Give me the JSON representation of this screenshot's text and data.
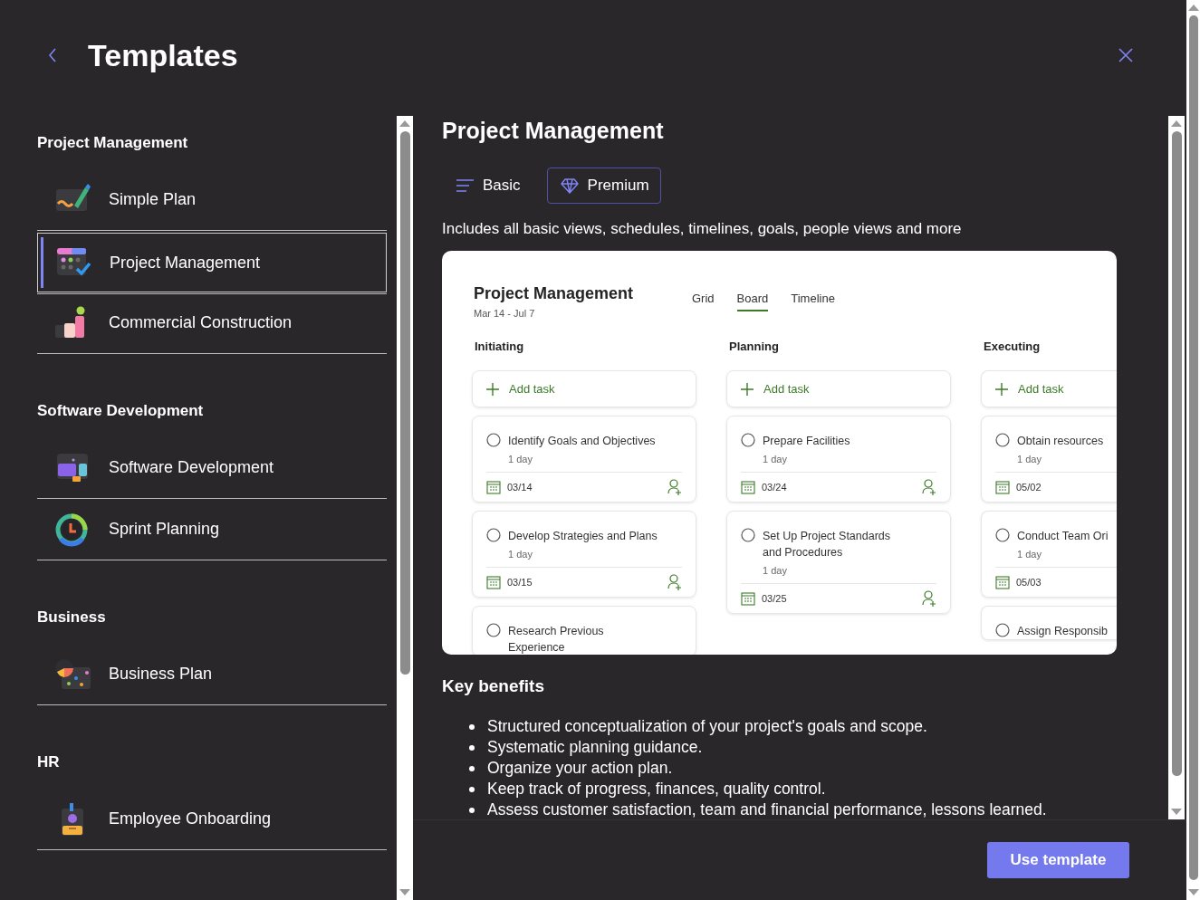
{
  "header": {
    "title": "Templates"
  },
  "sidebar": {
    "groups": [
      {
        "title": "Project Management",
        "items": [
          {
            "label": "Simple Plan",
            "selected": false
          },
          {
            "label": "Project Management",
            "selected": true
          },
          {
            "label": "Commercial Construction",
            "selected": false
          }
        ]
      },
      {
        "title": "Software Development",
        "items": [
          {
            "label": "Software Development",
            "selected": false
          },
          {
            "label": "Sprint Planning",
            "selected": false
          }
        ]
      },
      {
        "title": "Business",
        "items": [
          {
            "label": "Business Plan",
            "selected": false
          }
        ]
      },
      {
        "title": "HR",
        "items": [
          {
            "label": "Employee Onboarding",
            "selected": false
          }
        ]
      }
    ]
  },
  "detail": {
    "title": "Project Management",
    "plans": [
      {
        "label": "Basic",
        "selected": false
      },
      {
        "label": "Premium",
        "selected": true
      }
    ],
    "description": "Includes all basic views, schedules, timelines, goals, people views and more",
    "preview": {
      "title": "Project Management",
      "dates": "Mar 14 - Jul 7",
      "views": [
        {
          "label": "Grid",
          "selected": false
        },
        {
          "label": "Board",
          "selected": true
        },
        {
          "label": "Timeline",
          "selected": false
        }
      ],
      "columns": [
        {
          "name": "Initiating",
          "add_label": "Add task",
          "tasks": [
            {
              "title": "Identify Goals and Objectives",
              "duration": "1 day",
              "date": "03/14"
            },
            {
              "title": "Develop Strategies and Plans",
              "duration": "1 day",
              "date": "03/15"
            },
            {
              "title": "Research Previous Experience"
            }
          ]
        },
        {
          "name": "Planning",
          "add_label": "Add task",
          "tasks": [
            {
              "title": "Prepare Facilities",
              "duration": "1 day",
              "date": "03/24"
            },
            {
              "title": "Set Up Project Standards and Procedures",
              "duration": "1 day",
              "date": "03/25"
            }
          ]
        },
        {
          "name": "Executing",
          "add_label": "Add task",
          "tasks": [
            {
              "title": "Obtain resources",
              "duration": "1 day",
              "date": "05/02"
            },
            {
              "title": "Conduct Team Ori",
              "duration": "1 day",
              "date": "05/03"
            },
            {
              "title": "Assign Responsib"
            }
          ]
        }
      ]
    },
    "benefits_title": "Key benefits",
    "benefits": [
      "Structured conceptualization of your project's goals and scope.",
      "Systematic planning guidance.",
      "Organize your action plan.",
      "Keep track of progress, finances, quality control.",
      "Assess customer satisfaction, team and financial performance, lessons learned."
    ]
  },
  "footer": {
    "primary_button": "Use template"
  }
}
